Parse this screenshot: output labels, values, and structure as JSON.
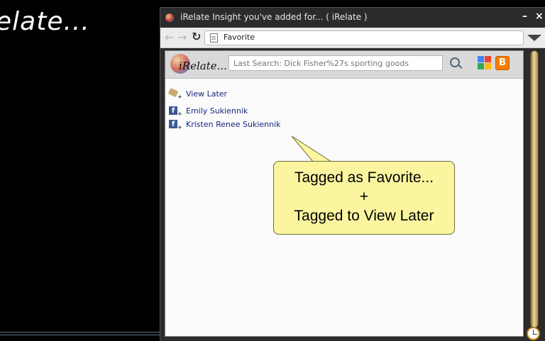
{
  "background": {
    "text": "elate..."
  },
  "window": {
    "title": "iRelate Insight you've added for... ( iRelate )",
    "minimize_glyph": "–",
    "close_glyph": "×"
  },
  "navbar": {
    "back_icon": "back-arrow-icon",
    "forward_icon": "forward-arrow-icon",
    "reload_icon": "reload-icon",
    "address": "Favorite"
  },
  "panel": {
    "logo_text": "iRelate...",
    "search": {
      "placeholder": "Last Search: Dick Fisher%27s sporting goods"
    },
    "icons": [
      "search-icon",
      "google-icon",
      "blogger-icon"
    ],
    "items": [
      {
        "icon": "tag-icon",
        "label": "View Later"
      },
      {
        "icon": "facebook-icon",
        "label": "Emily Sukiennik"
      },
      {
        "icon": "facebook-icon",
        "label": "Kristen Renee Sukiennik"
      }
    ]
  },
  "tooltip": {
    "line1": "Tagged as Favorite...",
    "line2": "+",
    "line3": "Tagged to View Later"
  },
  "colors": {
    "tooltip_bg": "#fbf5a0",
    "facebook": "#3b5998",
    "link": "#1a237e",
    "blogger": "#f57d00"
  }
}
